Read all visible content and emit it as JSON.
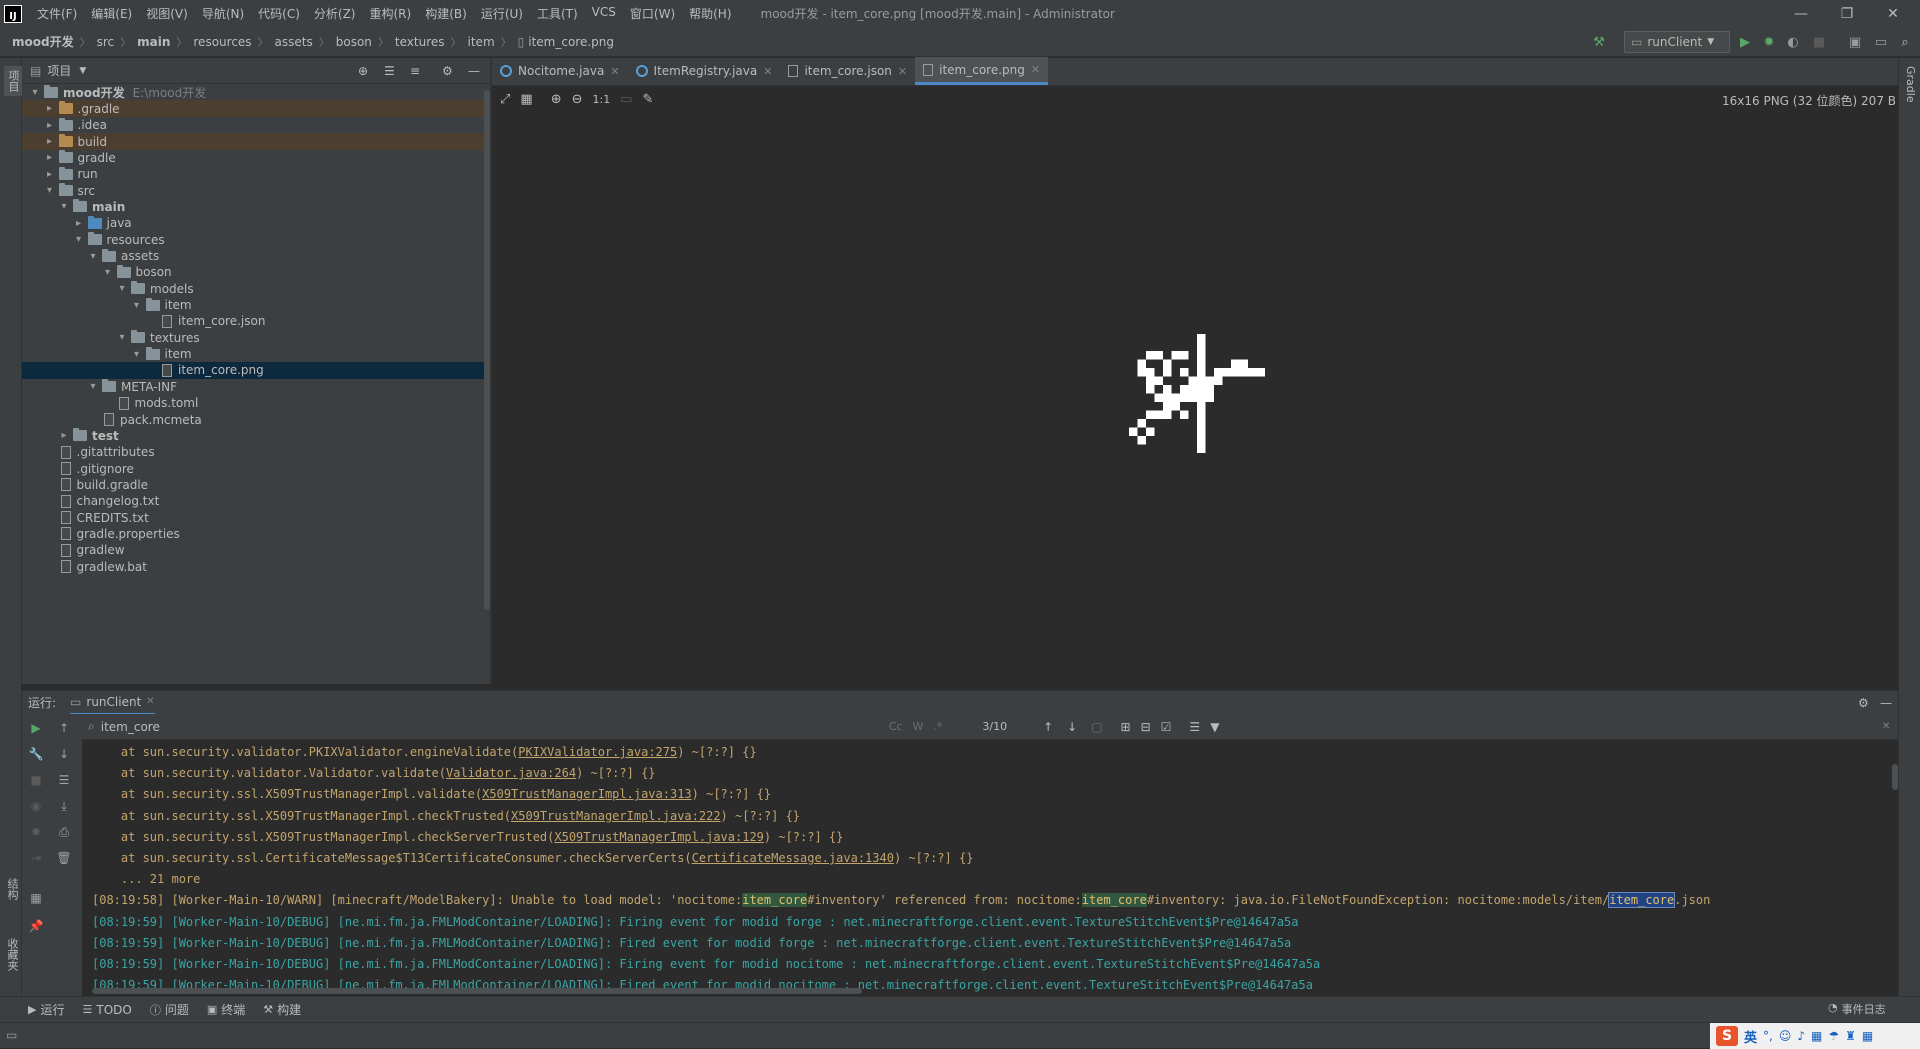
{
  "menubar": {
    "logo": "IJ",
    "items": [
      "文件(F)",
      "编辑(E)",
      "视图(V)",
      "导航(N)",
      "代码(C)",
      "分析(Z)",
      "重构(R)",
      "构建(B)",
      "运行(U)",
      "工具(T)",
      "VCS",
      "窗口(W)",
      "帮助(H)"
    ],
    "title": "mood开发 - item_core.png [mood开发.main] - Administrator"
  },
  "breadcrumb": [
    "mood开发",
    "src",
    "main",
    "resources",
    "assets",
    "boson",
    "textures",
    "item",
    "item_core.png"
  ],
  "toolbar": {
    "run_config": "runClient"
  },
  "left_tool_tabs": [
    "项目",
    "结构",
    "收藏夹"
  ],
  "right_tool_tabs": [
    "Gradle"
  ],
  "project_panel": {
    "title": "项目"
  },
  "tree": [
    {
      "label": "mood开发",
      "sub": "E:\\mood开发",
      "depth": 0,
      "arrow": "▾",
      "type": "folder",
      "bold": true
    },
    {
      "label": ".gradle",
      "depth": 1,
      "arrow": "▸",
      "type": "folder-orange",
      "hl": true
    },
    {
      "label": ".idea",
      "depth": 1,
      "arrow": "▸",
      "type": "folder"
    },
    {
      "label": "build",
      "depth": 1,
      "arrow": "▸",
      "type": "folder-orange",
      "hl": true
    },
    {
      "label": "gradle",
      "depth": 1,
      "arrow": "▸",
      "type": "folder"
    },
    {
      "label": "run",
      "depth": 1,
      "arrow": "▸",
      "type": "folder"
    },
    {
      "label": "src",
      "depth": 1,
      "arrow": "▾",
      "type": "folder"
    },
    {
      "label": "main",
      "depth": 2,
      "arrow": "▾",
      "type": "folder",
      "bold": true
    },
    {
      "label": "java",
      "depth": 3,
      "arrow": "▸",
      "type": "folder-blue"
    },
    {
      "label": "resources",
      "depth": 3,
      "arrow": "▾",
      "type": "folder"
    },
    {
      "label": "assets",
      "depth": 4,
      "arrow": "▾",
      "type": "folder"
    },
    {
      "label": "boson",
      "depth": 5,
      "arrow": "▾",
      "type": "folder"
    },
    {
      "label": "models",
      "depth": 6,
      "arrow": "▾",
      "type": "folder"
    },
    {
      "label": "item",
      "depth": 7,
      "arrow": "▾",
      "type": "folder"
    },
    {
      "label": "item_core.json",
      "depth": 8,
      "arrow": "",
      "type": "file"
    },
    {
      "label": "textures",
      "depth": 6,
      "arrow": "▾",
      "type": "folder"
    },
    {
      "label": "item",
      "depth": 7,
      "arrow": "▾",
      "type": "folder"
    },
    {
      "label": "item_core.png",
      "depth": 8,
      "arrow": "",
      "type": "file",
      "selected": true
    },
    {
      "label": "META-INF",
      "depth": 4,
      "arrow": "▾",
      "type": "folder"
    },
    {
      "label": "mods.toml",
      "depth": 5,
      "arrow": "",
      "type": "file"
    },
    {
      "label": "pack.mcmeta",
      "depth": 4,
      "arrow": "",
      "type": "file"
    },
    {
      "label": "test",
      "depth": 2,
      "arrow": "▸",
      "type": "folder",
      "bold": true
    },
    {
      "label": ".gitattributes",
      "depth": 1,
      "arrow": "",
      "type": "file"
    },
    {
      "label": ".gitignore",
      "depth": 1,
      "arrow": "",
      "type": "file"
    },
    {
      "label": "build.gradle",
      "depth": 1,
      "arrow": "",
      "type": "file"
    },
    {
      "label": "changelog.txt",
      "depth": 1,
      "arrow": "",
      "type": "file"
    },
    {
      "label": "CREDITS.txt",
      "depth": 1,
      "arrow": "",
      "type": "file"
    },
    {
      "label": "gradle.properties",
      "depth": 1,
      "arrow": "",
      "type": "file"
    },
    {
      "label": "gradlew",
      "depth": 1,
      "arrow": "",
      "type": "file"
    },
    {
      "label": "gradlew.bat",
      "depth": 1,
      "arrow": "",
      "type": "file"
    }
  ],
  "tabs": [
    {
      "label": "Nocitome.java",
      "icon": "class"
    },
    {
      "label": "ItemRegistry.java",
      "icon": "class"
    },
    {
      "label": "item_core.json",
      "icon": "file"
    },
    {
      "label": "item_core.png",
      "icon": "file",
      "active": true
    }
  ],
  "image_info": "16x16 PNG (32 位颜色) 207 B",
  "zoom_label": "1:1",
  "run_panel": {
    "label": "运行:",
    "tab": "runClient",
    "search_value": "item_core",
    "match_count": "3/10"
  },
  "console_lines": [
    {
      "c": "cy",
      "parts": [
        [
          "    at sun.security.validator.PKIXValidator.engineValidate(",
          ""
        ],
        [
          "PKIXValidator.java:275",
          "u"
        ],
        [
          ") ~[?:?] {}",
          ""
        ]
      ]
    },
    {
      "c": "cy",
      "parts": [
        [
          "    at sun.security.validator.Validator.validate(",
          ""
        ],
        [
          "Validator.java:264",
          "u"
        ],
        [
          ") ~[?:?] {}",
          ""
        ]
      ]
    },
    {
      "c": "cy",
      "parts": [
        [
          "    at sun.security.ssl.X509TrustManagerImpl.validate(",
          ""
        ],
        [
          "X509TrustManagerImpl.java:313",
          "u"
        ],
        [
          ") ~[?:?] {}",
          ""
        ]
      ]
    },
    {
      "c": "cy",
      "parts": [
        [
          "    at sun.security.ssl.X509TrustManagerImpl.checkTrusted(",
          ""
        ],
        [
          "X509TrustManagerImpl.java:222",
          "u"
        ],
        [
          ") ~[?:?] {}",
          ""
        ]
      ]
    },
    {
      "c": "cy",
      "parts": [
        [
          "    at sun.security.ssl.X509TrustManagerImpl.checkServerTrusted(",
          ""
        ],
        [
          "X509TrustManagerImpl.java:129",
          "u"
        ],
        [
          ") ~[?:?] {}",
          ""
        ]
      ]
    },
    {
      "c": "cy",
      "parts": [
        [
          "    at sun.security.ssl.CertificateMessage$T13CertificateConsumer.checkServerCerts(",
          ""
        ],
        [
          "CertificateMessage.java:1340",
          "u"
        ],
        [
          ") ~[?:?] {}",
          ""
        ]
      ]
    },
    {
      "c": "cy",
      "parts": [
        [
          "    ... 21 more",
          ""
        ]
      ]
    },
    {
      "c": "cy",
      "parts": [
        [
          "[08:19:58] [Worker-Main-10/WARN] [minecraft/ModelBakery]: Unable to load model: 'nocitome:",
          ""
        ],
        [
          "item_core",
          "mk"
        ],
        [
          "#inventory' referenced from: nocitome:",
          ""
        ],
        [
          "item_core",
          "mk"
        ],
        [
          "#inventory: java.io.FileNotFoundException: nocitome:models/item/",
          ""
        ],
        [
          "item_core",
          "mk2"
        ],
        [
          ".json",
          ""
        ]
      ]
    },
    {
      "c": "cg",
      "parts": [
        [
          "[08:19:59] [Worker-Main-10/DEBUG] [ne.mi.fm.ja.FMLModContainer/LOADING]: Firing event for modid forge : net.minecraftforge.client.event.TextureStitchEvent$Pre@14647a5a",
          ""
        ]
      ]
    },
    {
      "c": "cg",
      "parts": [
        [
          "[08:19:59] [Worker-Main-10/DEBUG] [ne.mi.fm.ja.FMLModContainer/LOADING]: Fired event for modid forge : net.minecraftforge.client.event.TextureStitchEvent$Pre@14647a5a",
          ""
        ]
      ]
    },
    {
      "c": "cg",
      "parts": [
        [
          "[08:19:59] [Worker-Main-10/DEBUG] [ne.mi.fm.ja.FMLModContainer/LOADING]: Firing event for modid nocitome : net.minecraftforge.client.event.TextureStitchEvent$Pre@14647a5a",
          ""
        ]
      ]
    },
    {
      "c": "cg",
      "parts": [
        [
          "[08:19:59] [Worker-Main-10/DEBUG] [ne.mi.fm.ja.FMLModContainer/LOADING]: Fired event for modid nocitome : net.minecraftforge.client.event.TextureStitchEvent$Pre@14647a5a",
          ""
        ]
      ]
    }
  ],
  "bottom_tabs": [
    "运行",
    "TODO",
    "问题",
    "终端",
    "构建"
  ],
  "status": {
    "event_log": "事件日志",
    "ime": "英"
  },
  "colors": {
    "selection": "#0d293e",
    "accent": "#4a88c7",
    "ignored": "#4c3f30"
  }
}
